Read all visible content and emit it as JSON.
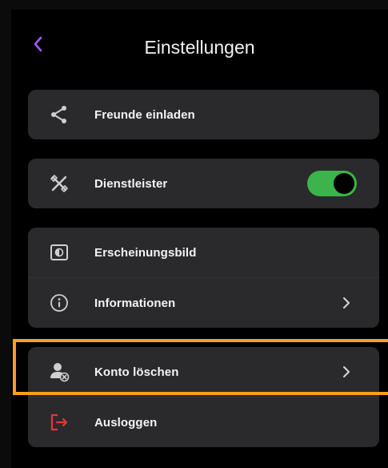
{
  "header": {
    "title": "Einstellungen",
    "back_icon": "chevron-left-icon"
  },
  "colors": {
    "accent": "#a25af4",
    "toggle_on": "#3cb44b",
    "logout": "#e8343a",
    "highlight": "#f0a21f",
    "card": "#2a2a2c"
  },
  "menu": {
    "invite_label": "Freunde einladen",
    "provider_label": "Dienstleister",
    "provider_toggle_on": true,
    "appearance_label": "Erscheinungsbild",
    "info_label": "Informationen",
    "delete_label": "Konto löschen",
    "logout_label": "Ausloggen"
  }
}
